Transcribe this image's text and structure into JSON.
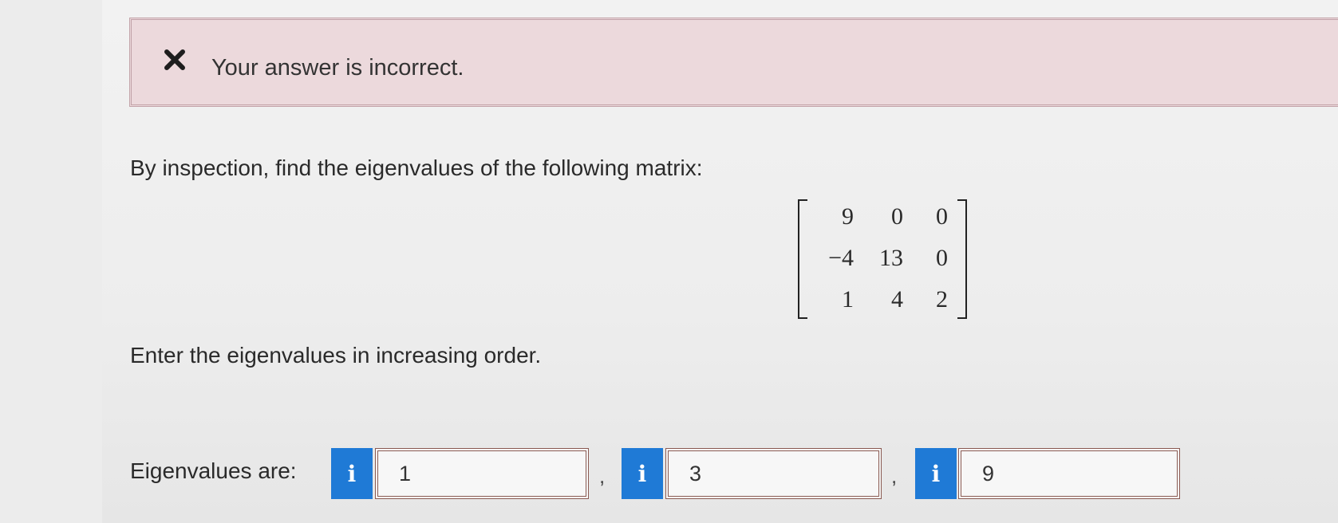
{
  "feedback": {
    "message": "Your answer is incorrect.",
    "icon": "x-mark-icon"
  },
  "question": {
    "prompt": "By inspection, find the eigenvalues of the following matrix:",
    "matrix": [
      [
        "9",
        "0",
        "0"
      ],
      [
        "−4",
        "13",
        "0"
      ],
      [
        "1",
        "4",
        "2"
      ]
    ],
    "instruction": "Enter the eigenvalues in increasing order."
  },
  "answer": {
    "label": "Eigenvalues are:",
    "info_glyph": "i",
    "separator": ",",
    "values": [
      "1",
      "3",
      "9"
    ]
  },
  "colors": {
    "feedback_bg": "#ecd9dc",
    "info_button": "#1f7ad6",
    "answer_border": "#8a5a52"
  }
}
